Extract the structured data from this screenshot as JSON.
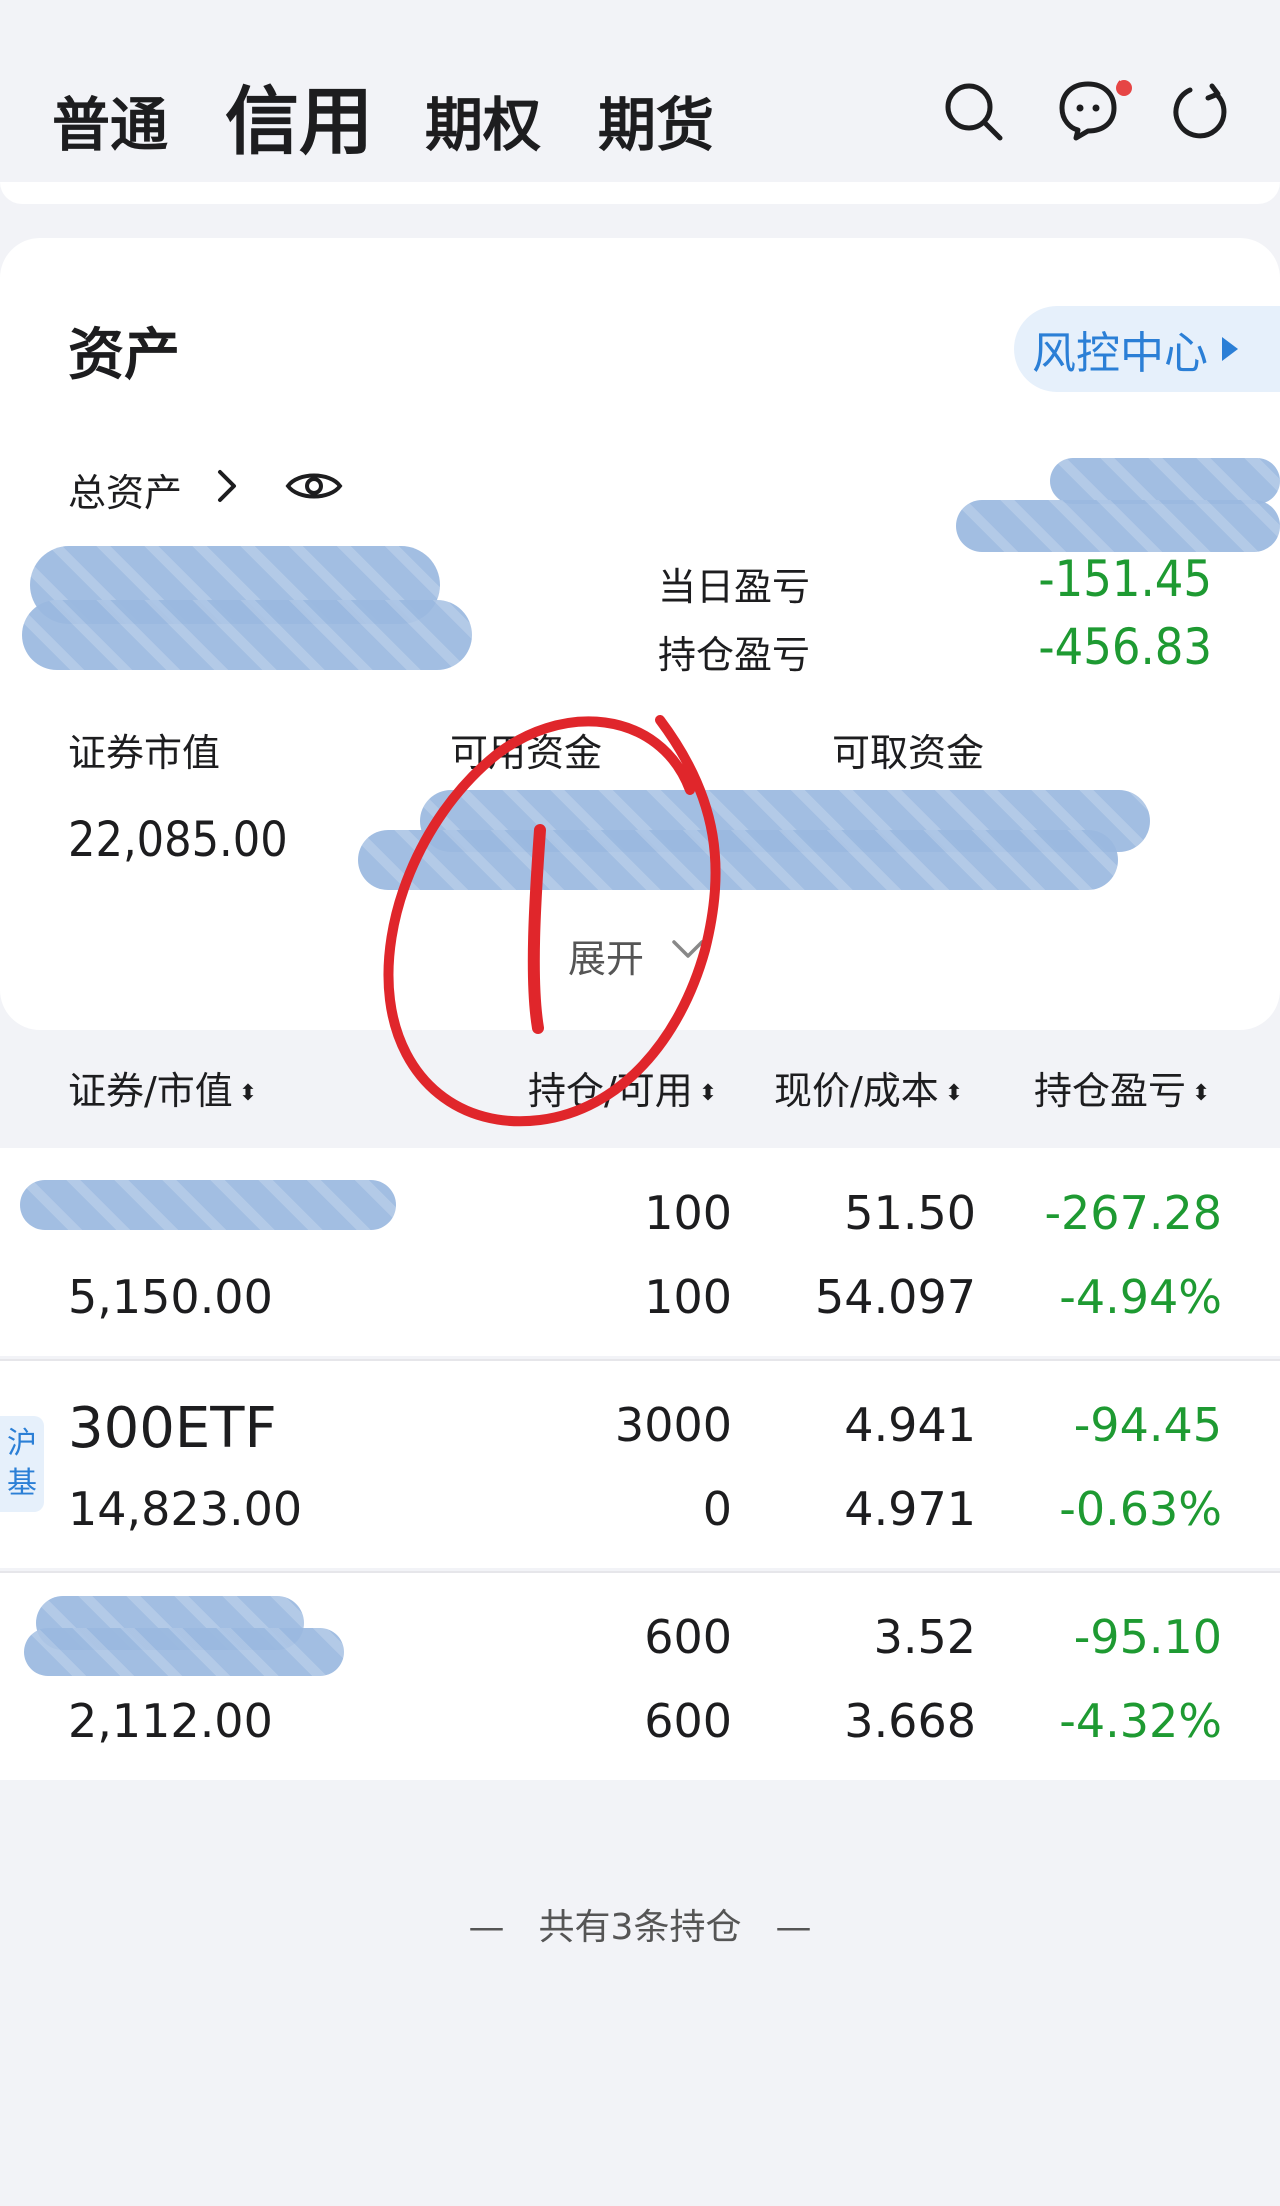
{
  "tabs": {
    "normal": "普通",
    "credit": "信用",
    "option": "期权",
    "futures": "期货"
  },
  "asset": {
    "title": "资产",
    "risk_center": "风控中心",
    "total_assets_label": "总资产",
    "daily_pnl_label": "当日盈亏",
    "daily_pnl_value": "-151.45",
    "position_pnl_label": "持仓盈亏",
    "position_pnl_value": "-456.83",
    "market_value_label": "证券市值",
    "market_value": "22,085.00",
    "available_funds_label": "可用资金",
    "withdrawable_funds_label": "可取资金",
    "expand_label": "展开"
  },
  "columns": {
    "security": "证券/市值",
    "position": "持仓/可用",
    "price": "现价/成本",
    "pnl": "持仓盈亏"
  },
  "positions": [
    {
      "name": "",
      "badge": "",
      "market_value": "5,150.00",
      "holding": "100",
      "available": "100",
      "price": "51.50",
      "cost": "54.097",
      "pnl": "-267.28",
      "pnl_pct": "-4.94%"
    },
    {
      "name": "300ETF",
      "badge": "沪基",
      "market_value": "14,823.00",
      "holding": "3000",
      "available": "0",
      "price": "4.941",
      "cost": "4.971",
      "pnl": "-94.45",
      "pnl_pct": "-0.63%"
    },
    {
      "name": "",
      "badge": "",
      "market_value": "2,112.00",
      "holding": "600",
      "available": "600",
      "price": "3.52",
      "cost": "3.668",
      "pnl": "-95.10",
      "pnl_pct": "-4.32%"
    }
  ],
  "footer": "共有3条持仓",
  "colors": {
    "accent": "#2b7fd6",
    "loss": "#1e9a32",
    "annotation": "#e0262b"
  }
}
